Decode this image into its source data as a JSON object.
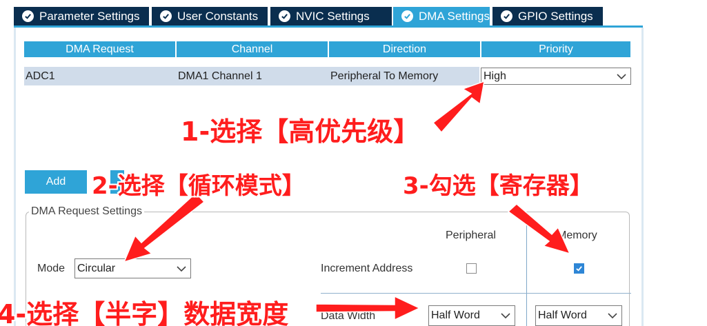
{
  "tabs": [
    {
      "label": "Parameter Settings",
      "active": false
    },
    {
      "label": "User Constants",
      "active": false
    },
    {
      "label": "NVIC Settings",
      "active": false
    },
    {
      "label": "DMA Settings",
      "active": true
    },
    {
      "label": "GPIO Settings",
      "active": false
    }
  ],
  "table": {
    "headers": [
      "DMA Request",
      "Channel",
      "Direction",
      "Priority"
    ],
    "rows": [
      {
        "request": "ADC1",
        "channel": "DMA1 Channel 1",
        "direction": "Peripheral To Memory",
        "priority": "High"
      }
    ]
  },
  "buttons": {
    "add": "Add"
  },
  "settings": {
    "group_title": "DMA Request Settings",
    "peripheral_label": "Peripheral",
    "memory_label": "Memory",
    "mode_label": "Mode",
    "mode_value": "Circular",
    "increment_label": "Increment Address",
    "increment_peripheral": false,
    "increment_memory": true,
    "data_width_label": "Data Width",
    "data_width_peripheral": "Half Word",
    "data_width_memory": "Half Word"
  },
  "annotations": {
    "a1": "1-选择【高优先级】",
    "a2": "2-选择【循环模式】",
    "a3": "3-勾选【寄存器】",
    "a4": "4-选择【半字】数据宽度"
  },
  "colors": {
    "tab_dark": "#0a2e4f",
    "accent": "#2fa4d7",
    "annotation_red": "#ff1d1d",
    "row_highlight": "#d0dcea",
    "checkbox_checked": "#2e86d6"
  }
}
